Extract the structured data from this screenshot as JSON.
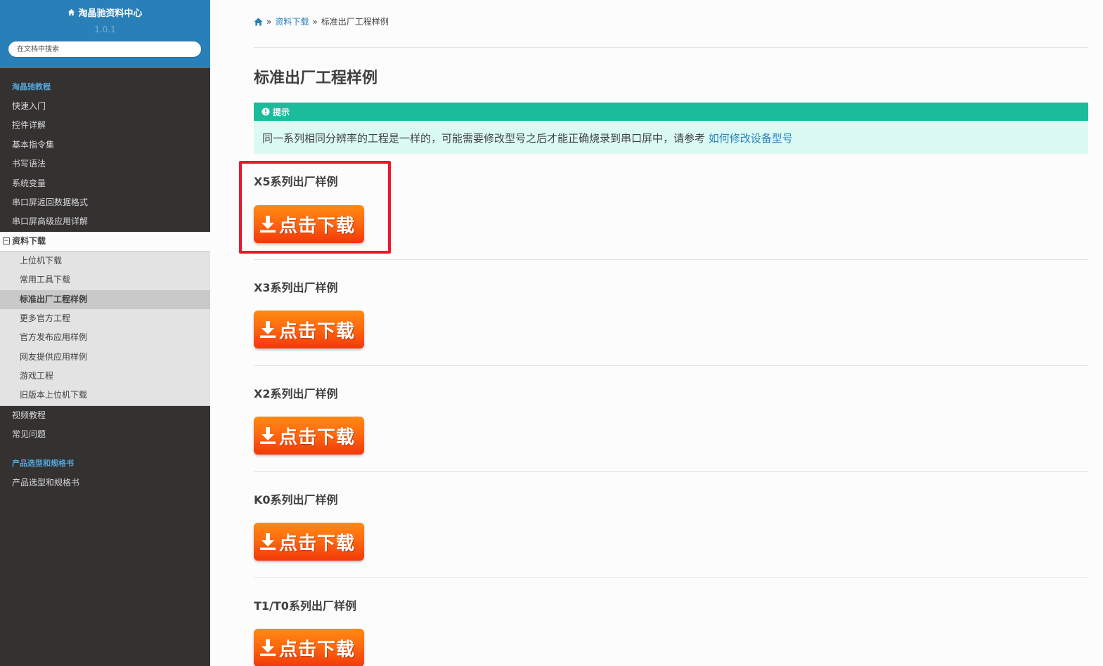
{
  "sidebar": {
    "title": "淘晶驰资料中心",
    "version": "1.0.1",
    "search_placeholder": "在文档中搜索",
    "caption_1": "淘晶驰教程",
    "items_top": [
      "快速入门",
      "控件详解",
      "基本指令集",
      "书写语法",
      "系统变量",
      "串口屏返回数据格式",
      "串口屏高级应用详解"
    ],
    "current_section": "资料下载",
    "toggle_symbol": "⊟",
    "sub_items": [
      "上位机下载",
      "常用工具下载",
      "标准出厂工程样例",
      "更多官方工程",
      "官方发布应用样例",
      "网友提供应用样例",
      "游戏工程",
      "旧版本上位机下载"
    ],
    "items_bottom": [
      "视频教程",
      "常见问题"
    ],
    "caption_2": "产品选型和规格书",
    "items_last": [
      "产品选型和规格书"
    ]
  },
  "breadcrumb": {
    "home_icon": "home-icon",
    "sep": "»",
    "link": "资料下载",
    "current": "标准出厂工程样例"
  },
  "page": {
    "title": "标准出厂工程样例"
  },
  "admonition": {
    "title": "提示",
    "body": "同一系列相同分辨率的工程是一样的，可能需要修改型号之后才能正确烧录到串口屏中，请参考",
    "link": "如何修改设备型号"
  },
  "sections": [
    {
      "title": "X5系列出厂样例",
      "button": "点击下载"
    },
    {
      "title": "X3系列出厂样例",
      "button": "点击下载"
    },
    {
      "title": "X2系列出厂样例",
      "button": "点击下载"
    },
    {
      "title": "K0系列出厂样例",
      "button": "点击下载"
    },
    {
      "title": "T1/T0系列出厂样例",
      "button": "点击下载"
    }
  ],
  "colors": {
    "sidebar_header": "#2980b9",
    "sidebar_bg": "#343131",
    "admonition_title": "#1abc9c",
    "admonition_bg": "#dbfaf4",
    "button_orange": "#ff6a10",
    "highlight_red": "#e8192c",
    "link": "#2980b9"
  }
}
